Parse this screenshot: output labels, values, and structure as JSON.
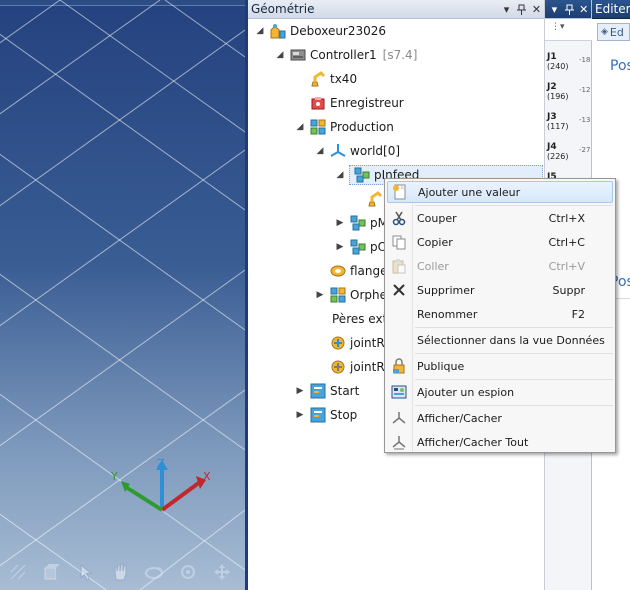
{
  "geometry_panel": {
    "title": "Géométrie",
    "tree": [
      {
        "label": "Deboxeur23026",
        "icon": "robot-cell-icon"
      },
      {
        "label": "Controller1",
        "tag": "[s7.4]",
        "icon": "controller-icon"
      },
      {
        "label": "tx40",
        "icon": "robot-arm-icon"
      },
      {
        "label": "Enregistreur",
        "icon": "recorder-icon"
      },
      {
        "label": "Production",
        "icon": "frame-group-icon"
      },
      {
        "label": "world[0]",
        "icon": "world-frame-icon"
      },
      {
        "label": "pInfeed",
        "icon": "point-group-icon"
      },
      {
        "label": "pM",
        "icon": "point-group-icon"
      },
      {
        "label": "pO",
        "icon": "point-group-icon"
      },
      {
        "label": "flange[",
        "icon": "flange-icon"
      },
      {
        "label": "Orphel",
        "icon": "frame-group-icon"
      },
      {
        "label": "Pères exte",
        "icon": ""
      },
      {
        "label": "jointRx",
        "icon": "joint-icon"
      },
      {
        "label": "jointRs",
        "icon": "joint-icon"
      },
      {
        "label": "Start",
        "icon": "program-icon"
      },
      {
        "label": "Stop",
        "icon": "program-icon"
      }
    ]
  },
  "context_menu": {
    "items": [
      {
        "label": "Ajouter une valeur",
        "shortcut": "",
        "icon": "add-value-icon"
      },
      {
        "label": "Couper",
        "shortcut": "Ctrl+X",
        "icon": "scissors-icon"
      },
      {
        "label": "Copier",
        "shortcut": "Ctrl+C",
        "icon": "copy-icon"
      },
      {
        "label": "Coller",
        "shortcut": "Ctrl+V",
        "icon": "paste-icon"
      },
      {
        "label": "Supprimer",
        "shortcut": "Suppr",
        "icon": "delete-x-icon"
      },
      {
        "label": "Renommer",
        "shortcut": "F2",
        "icon": ""
      },
      {
        "label": "Sélectionner dans la vue Données",
        "shortcut": "",
        "icon": ""
      },
      {
        "label": "Publique",
        "shortcut": "",
        "icon": "public-lock-icon"
      },
      {
        "label": "Ajouter un espion",
        "shortcut": "",
        "icon": "spy-icon"
      },
      {
        "label": "Afficher/Cacher",
        "shortcut": "",
        "icon": "show-hide-icon"
      },
      {
        "label": "Afficher/Cacher Tout",
        "shortcut": "",
        "icon": "show-hide-all-icon"
      }
    ]
  },
  "joints_panel": {
    "joints": [
      {
        "name": "J1",
        "sub": "(240)",
        "value": "-18"
      },
      {
        "name": "J2",
        "sub": "(196)",
        "value": "-12"
      },
      {
        "name": "J3",
        "sub": "(117)",
        "value": "-13"
      },
      {
        "name": "J4",
        "sub": "(226)",
        "value": "-27"
      },
      {
        "name": "J5",
        "sub": "",
        "value": ""
      }
    ]
  },
  "editor_panel": {
    "title": "Editer",
    "button_label": "Ed",
    "section_label_1": "Pos",
    "section_label_2": "Pos"
  },
  "viewport": {
    "axis_x": "X",
    "axis_y": "Y",
    "axis_z": "Z"
  },
  "colors": {
    "accent": "#3570b8",
    "selection": "#e3eefb",
    "axis_x": "#c0282d",
    "axis_y": "#2f9a2f",
    "axis_z": "#2e8fd8"
  }
}
